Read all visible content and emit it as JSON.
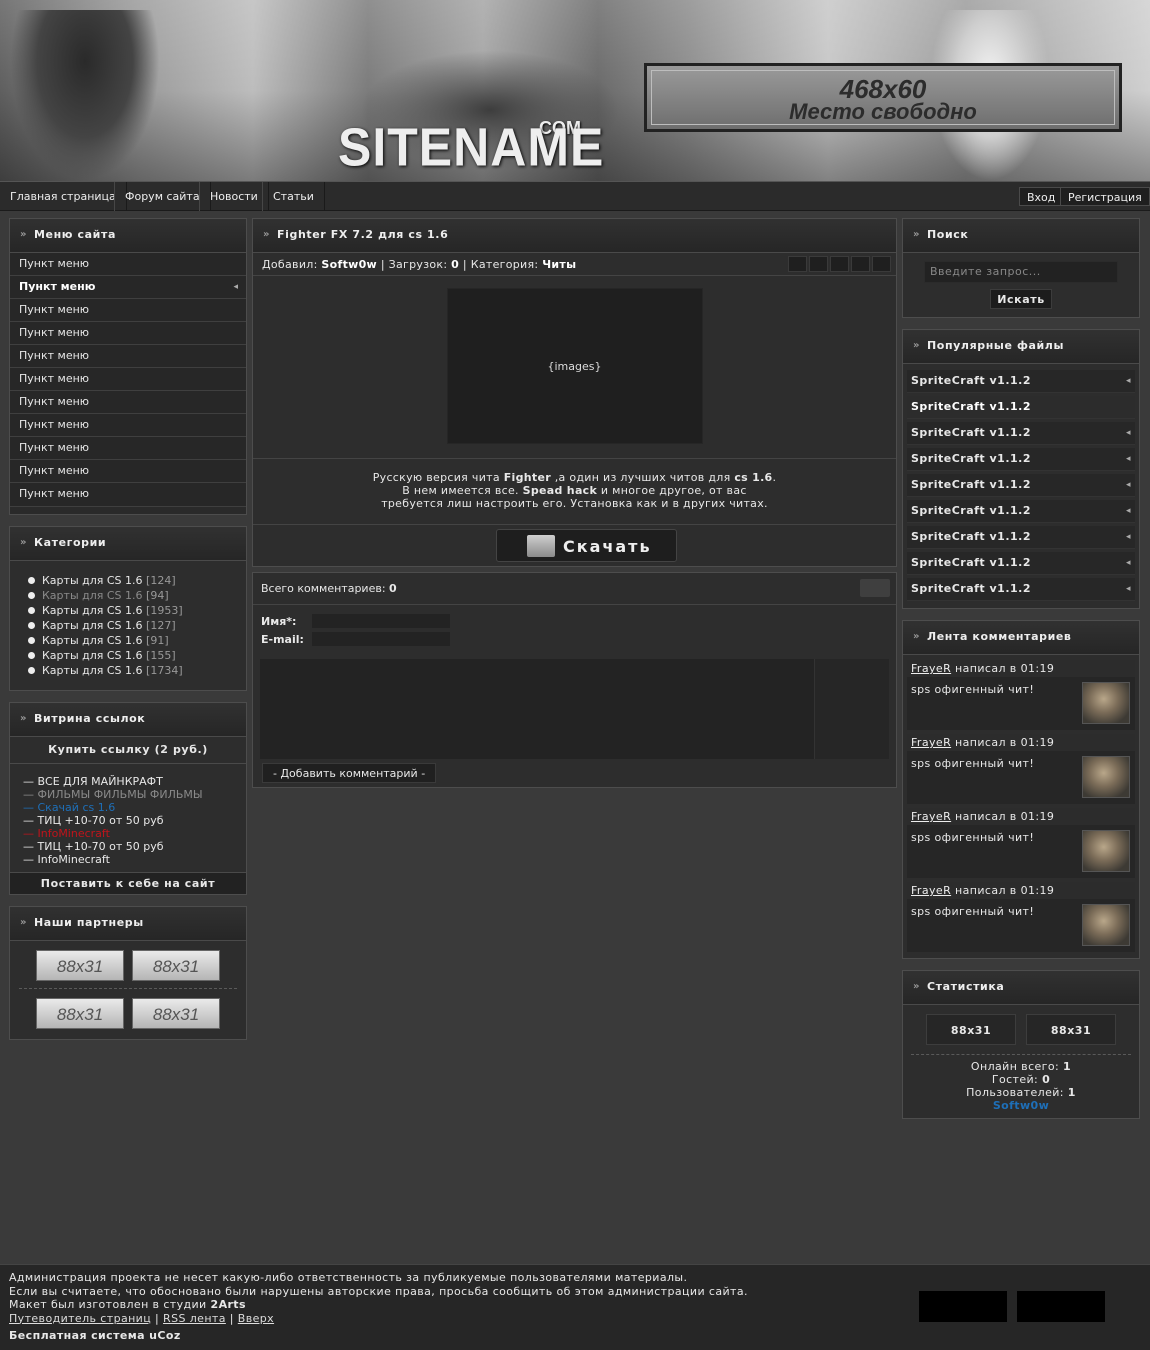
{
  "header": {
    "logo": "SITENAME",
    "logo_suffix": ".COM",
    "banner_line1": "468x60",
    "banner_line2": "Место свободно"
  },
  "nav": {
    "items": [
      "Главная страница",
      "Форум сайта",
      "Новости",
      "Статьи"
    ],
    "login": "Вход",
    "register": "Регистрация"
  },
  "left": {
    "menu_title": "Меню сайта",
    "menu_items": [
      "Пункт меню",
      "Пункт меню",
      "Пункт меню",
      "Пункт меню",
      "Пункт меню",
      "Пункт меню",
      "Пункт меню",
      "Пункт меню",
      "Пункт меню",
      "Пункт меню",
      "Пункт меню"
    ],
    "categories_title": "Категории",
    "categories": [
      {
        "name": "Карты для CS 1.6",
        "count": "[124]"
      },
      {
        "name": "Карты для CS 1.6",
        "count": "[94]"
      },
      {
        "name": "Карты для CS 1.6",
        "count": "[1953]"
      },
      {
        "name": "Карты для CS 1.6",
        "count": "[127]"
      },
      {
        "name": "Карты для CS 1.6",
        "count": "[91]"
      },
      {
        "name": "Карты для CS 1.6",
        "count": "[155]"
      },
      {
        "name": "Карты для CS 1.6",
        "count": "[1734]"
      }
    ],
    "showcase_title": "Витрина ссылок",
    "buy_link": "Купить ссылку (2 руб.)",
    "links": [
      {
        "text": "— ВСЕ ДЛЯ МАЙНКРАФТ",
        "color": "#e8e8e8"
      },
      {
        "text": "— ФИЛЬМЫ ФИЛЬМЫ ФИЛЬМЫ",
        "color": "#8a8a8a"
      },
      {
        "text": "— Скачай cs 1.6",
        "color": "#1e6fb8"
      },
      {
        "text": "— ТИЦ +10-70 от 50 руб",
        "color": "#e8e8e8"
      },
      {
        "text": "— InfoMinecraft",
        "color": "#c0141b"
      },
      {
        "text": "— ТИЦ +10-70 от 50 руб",
        "color": "#e8e8e8"
      },
      {
        "text": "— InfoMinecraft",
        "color": "#e8e8e8"
      }
    ],
    "put_link": "Поставить к себе на сайт",
    "partners_title": "Наши партнеры",
    "partner_label": "88x31"
  },
  "center": {
    "title": "Fighter FX 7.2 для cs 1.6",
    "meta_added_label": "Добавил:",
    "meta_author": "Softw0w",
    "meta_downloads_label": "Загрузок:",
    "meta_downloads": "0",
    "meta_category_label": "Категория:",
    "meta_category": "Читы",
    "images_placeholder": "{images}",
    "desc_1a": "Русскую версия чита ",
    "desc_1b": "Fighter",
    "desc_1c": " ,а один из лучших читов для ",
    "desc_1d": "cs 1.6",
    "desc_1e": ".",
    "desc_2a": "В нем имеется все. ",
    "desc_2b": "Spead hack",
    "desc_2c": " и многое другое, от вас",
    "desc_3": "требуется лиш настроить его. Установка как и в других читах.",
    "download": "Скачать",
    "comments_label": "Всего комментариев:",
    "comments_count": "0",
    "name_label": "Имя*:",
    "email_label": "E-mail:",
    "add_comment": "- Добавить комментарий -"
  },
  "right": {
    "search_title": "Поиск",
    "search_placeholder": "Введите запрос...",
    "search_button": "Искать",
    "popular_title": "Популярные файлы",
    "popular_items": [
      "SpriteCraft v1.1.2",
      "SpriteCraft v1.1.2",
      "SpriteCraft v1.1.2",
      "SpriteCraft v1.1.2",
      "SpriteCraft v1.1.2",
      "SpriteCraft v1.1.2",
      "SpriteCraft v1.1.2",
      "SpriteCraft v1.1.2",
      "SpriteCraft v1.1.2"
    ],
    "feed_title": "Лента комментариев",
    "feed_items": [
      {
        "user": "FrayeR",
        "wrote": " написал в 01:19",
        "text": "sps офигенный чит!"
      },
      {
        "user": "FrayeR",
        "wrote": " написал в 01:19",
        "text": "sps офигенный чит!"
      },
      {
        "user": "FrayeR",
        "wrote": " написал в 01:19",
        "text": "sps офигенный чит!"
      },
      {
        "user": "FrayeR",
        "wrote": " написал в 01:19",
        "text": "sps офигенный чит!"
      }
    ],
    "stats_title": "Статистика",
    "stats_88": "88x31",
    "online_label": "Онлайн всего:",
    "online": "1",
    "guests_label": "Гостей:",
    "guests": "0",
    "users_label": "Пользователей:",
    "users": "1",
    "user_name": "Softw0w"
  },
  "footer": {
    "line1": "Администрация проекта не несет какую-либо ответственность за публикуемые пользователями материалы.",
    "line2": "Если вы считаете, что обосновано были нарушены авторские права, просьба сообщить об этом администрации сайта.",
    "line3a": "Макет был изготовлен в студии ",
    "line3b": "2Arts",
    "link_sitemap": "Путеводитель страниц",
    "link_rss": "RSS лента",
    "link_top": "Вверх",
    "ucoz": "Бесплатная система uCoz"
  }
}
